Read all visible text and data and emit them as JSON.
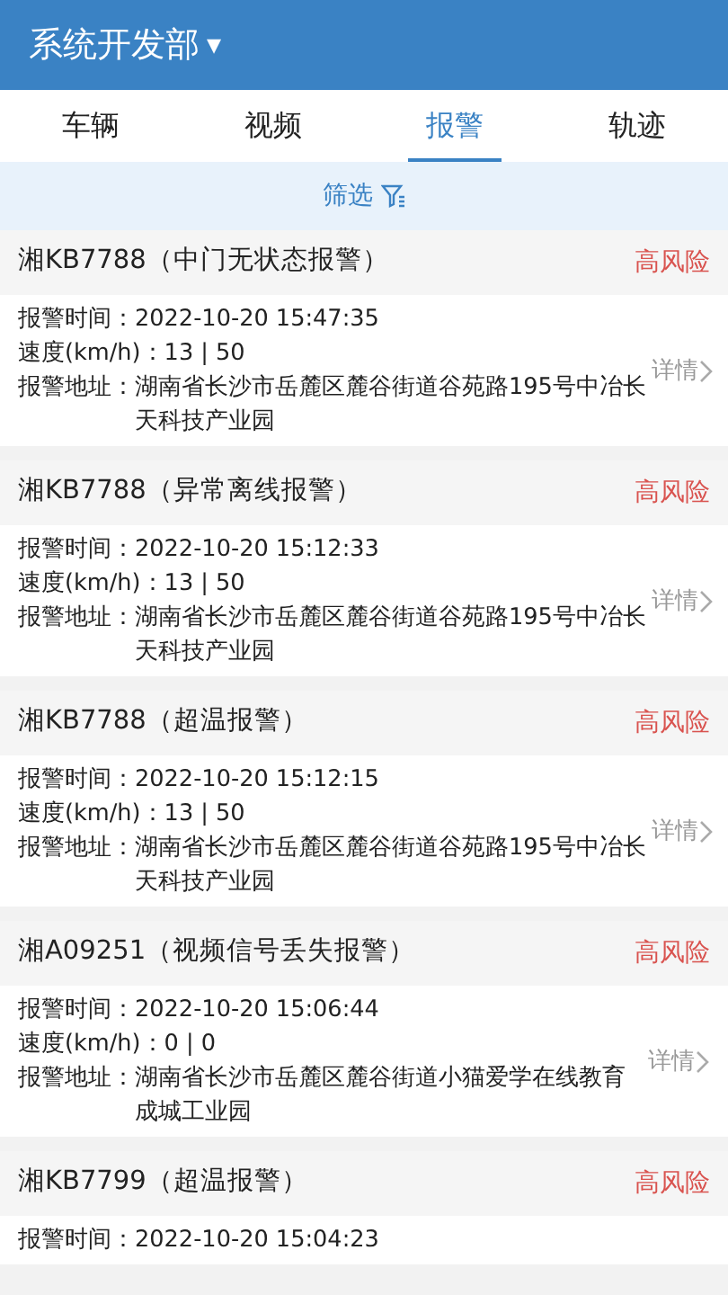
{
  "header": {
    "title": "系统开发部",
    "dropdown": "▾"
  },
  "tabs": [
    {
      "label": "车辆",
      "selected": false
    },
    {
      "label": "视频",
      "selected": false
    },
    {
      "label": "报警",
      "selected": true
    },
    {
      "label": "轨迹",
      "selected": false
    }
  ],
  "filter": {
    "label": "筛选"
  },
  "alarms": [
    {
      "title": "湘KB7788（中门无状态报警）",
      "risk": "高风险",
      "fields": [
        {
          "label": "报警时间：",
          "value": "2022-10-20 15:47:35"
        },
        {
          "label": "速度(km/h)：",
          "value": "13 | 50"
        },
        {
          "label": "报警地址：",
          "value": "湖南省长沙市岳麓区麓谷街道谷苑路195号中冶长天科技产业园"
        }
      ],
      "detail": "详情"
    },
    {
      "title": "湘KB7788（异常离线报警）",
      "risk": "高风险",
      "fields": [
        {
          "label": "报警时间：",
          "value": "2022-10-20 15:12:33"
        },
        {
          "label": "速度(km/h)：",
          "value": "13 | 50"
        },
        {
          "label": "报警地址：",
          "value": "湖南省长沙市岳麓区麓谷街道谷苑路195号中冶长天科技产业园"
        }
      ],
      "detail": "详情"
    },
    {
      "title": "湘KB7788（超温报警）",
      "risk": "高风险",
      "fields": [
        {
          "label": "报警时间：",
          "value": "2022-10-20 15:12:15"
        },
        {
          "label": "速度(km/h)：",
          "value": "13 | 50"
        },
        {
          "label": "报警地址：",
          "value": "湖南省长沙市岳麓区麓谷街道谷苑路195号中冶长天科技产业园"
        }
      ],
      "detail": "详情"
    },
    {
      "title": "湘A09251（视频信号丢失报警）",
      "risk": "高风险",
      "fields": [
        {
          "label": "报警时间：",
          "value": "2022-10-20 15:06:44"
        },
        {
          "label": "速度(km/h)：",
          "value": "0 | 0"
        },
        {
          "label": "报警地址：",
          "value": "湖南省长沙市岳麓区麓谷街道小猫爱学在线教育成城工业园"
        }
      ],
      "detail": "详情"
    },
    {
      "title": "湘KB7799（超温报警）",
      "risk": "高风险",
      "fields": [
        {
          "label": "报警时间：",
          "value": "2022-10-20 15:04:23"
        }
      ]
    }
  ]
}
